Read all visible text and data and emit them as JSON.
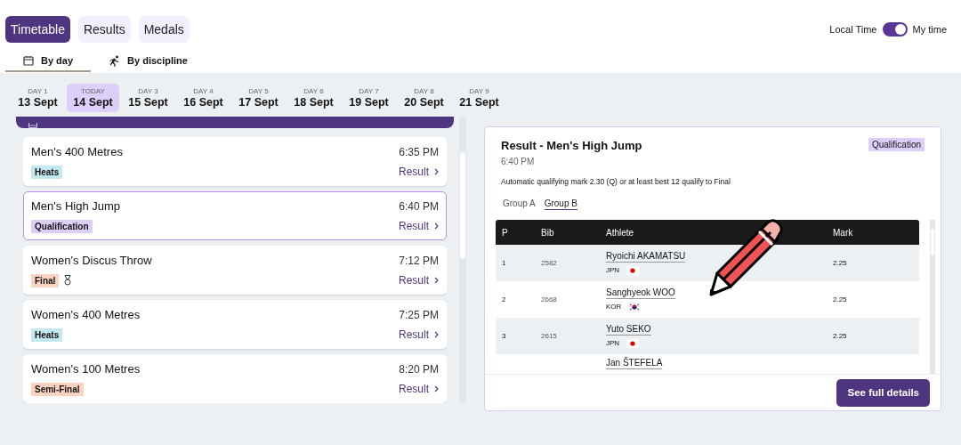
{
  "tabs": [
    {
      "label": "Timetable",
      "selected": true
    },
    {
      "label": "Results",
      "selected": false
    },
    {
      "label": "Medals",
      "selected": false
    }
  ],
  "time_toggle": {
    "left_label": "Local Time",
    "right_label": "My time",
    "on": true
  },
  "view_tabs": [
    {
      "label": "By day",
      "selected": true
    },
    {
      "label": "By discipline",
      "selected": false
    }
  ],
  "days": [
    {
      "day": "DAY 1",
      "date": "13 Sept",
      "selected": false
    },
    {
      "day": "TODAY",
      "date": "14 Sept",
      "selected": true
    },
    {
      "day": "DAY 3",
      "date": "15 Sept",
      "selected": false
    },
    {
      "day": "DAY 4",
      "date": "16 Sept",
      "selected": false
    },
    {
      "day": "DAY 5",
      "date": "17 Sept",
      "selected": false
    },
    {
      "day": "DAY 6",
      "date": "18 Sept",
      "selected": false
    },
    {
      "day": "DAY 7",
      "date": "19 Sept",
      "selected": false
    },
    {
      "day": "DAY 8",
      "date": "20 Sept",
      "selected": false
    },
    {
      "day": "DAY 9",
      "date": "21 Sept",
      "selected": false
    }
  ],
  "events": [
    {
      "name": "Men's 400 Metres",
      "time": "6:35 PM",
      "round": "Heats",
      "color": "#c4e8ef",
      "medal": false,
      "link": "Result",
      "selected": false
    },
    {
      "name": "Men's High Jump",
      "time": "6:40 PM",
      "round": "Qualification",
      "color": "#dccffa",
      "medal": false,
      "link": "Result",
      "selected": true
    },
    {
      "name": "Women's Discus Throw",
      "time": "7:12 PM",
      "round": "Final",
      "color": "#fbd3c0",
      "medal": true,
      "link": "Result",
      "selected": false
    },
    {
      "name": "Women's 400 Metres",
      "time": "7:25 PM",
      "round": "Heats",
      "color": "#c4e8ef",
      "medal": false,
      "link": "Result",
      "selected": false
    },
    {
      "name": "Women's 100 Metres",
      "time": "8:20 PM",
      "round": "Semi-Final",
      "color": "#fbd3c0",
      "medal": false,
      "link": "Result",
      "selected": false
    }
  ],
  "result": {
    "title": "Result - Men's High Jump",
    "time": "6:40 PM",
    "round": "Qualification",
    "note": "Automatic qualifying mark 2.30 (Q) or at least best 12 qualify to Final",
    "groups": [
      {
        "label": "Group A",
        "selected": false
      },
      {
        "label": "Group B",
        "selected": true
      }
    ],
    "table": {
      "columns": [
        "P",
        "Bib",
        "Athlete",
        "Mark"
      ],
      "rows": [
        {
          "p": "1",
          "bib": "2582",
          "athlete": "Ryoichi AKAMATSU",
          "country": "JPN",
          "kind": "japan",
          "mark": "2.25"
        },
        {
          "p": "2",
          "bib": "2668",
          "athlete": "Sanghyeok WOO",
          "country": "KOR",
          "kind": "korea",
          "mark": "2.25"
        },
        {
          "p": "3",
          "bib": "2615",
          "athlete": "Yuto SEKO",
          "country": "JPN",
          "kind": "japan",
          "mark": "2.25"
        },
        {
          "athlete": "Jan ŠTEFELA"
        }
      ]
    },
    "button": "See full details"
  }
}
